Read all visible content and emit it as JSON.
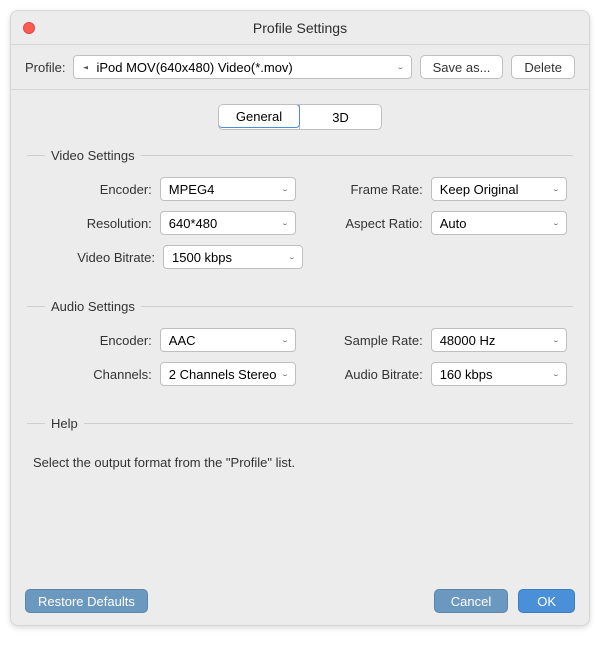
{
  "window": {
    "title": "Profile Settings"
  },
  "profile_row": {
    "label": "Profile:",
    "selected": "iPod MOV(640x480) Video(*.mov)",
    "save_as": "Save as...",
    "delete": "Delete"
  },
  "tabs": {
    "general": "General",
    "threed": "3D",
    "active": "general"
  },
  "video": {
    "group_title": "Video Settings",
    "encoder_label": "Encoder:",
    "encoder": "MPEG4",
    "resolution_label": "Resolution:",
    "resolution": "640*480",
    "bitrate_label": "Video Bitrate:",
    "bitrate": "1500 kbps",
    "framerate_label": "Frame Rate:",
    "framerate": "Keep Original",
    "aspect_label": "Aspect Ratio:",
    "aspect": "Auto"
  },
  "audio": {
    "group_title": "Audio Settings",
    "encoder_label": "Encoder:",
    "encoder": "AAC",
    "channels_label": "Channels:",
    "channels": "2 Channels Stereo",
    "samplerate_label": "Sample Rate:",
    "samplerate": "48000 Hz",
    "bitrate_label": "Audio Bitrate:",
    "bitrate": "160 kbps"
  },
  "help": {
    "group_title": "Help",
    "text": "Select the output format from the \"Profile\" list."
  },
  "footer": {
    "restore": "Restore Defaults",
    "cancel": "Cancel",
    "ok": "OK"
  }
}
